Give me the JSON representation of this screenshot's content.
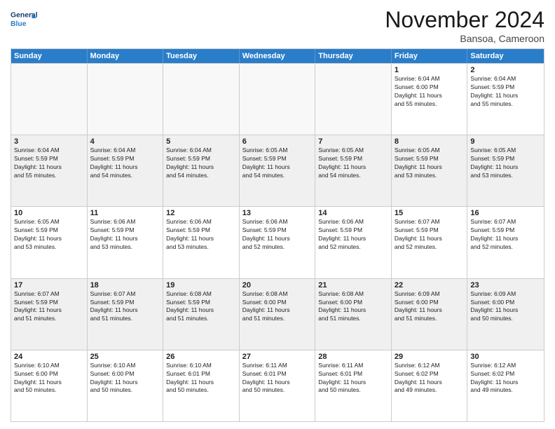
{
  "header": {
    "logo_general": "General",
    "logo_blue": "Blue",
    "month": "November 2024",
    "location": "Bansoa, Cameroon"
  },
  "weekdays": [
    "Sunday",
    "Monday",
    "Tuesday",
    "Wednesday",
    "Thursday",
    "Friday",
    "Saturday"
  ],
  "rows": [
    [
      {
        "day": "",
        "info": ""
      },
      {
        "day": "",
        "info": ""
      },
      {
        "day": "",
        "info": ""
      },
      {
        "day": "",
        "info": ""
      },
      {
        "day": "",
        "info": ""
      },
      {
        "day": "1",
        "info": "Sunrise: 6:04 AM\nSunset: 6:00 PM\nDaylight: 11 hours\nand 55 minutes."
      },
      {
        "day": "2",
        "info": "Sunrise: 6:04 AM\nSunset: 5:59 PM\nDaylight: 11 hours\nand 55 minutes."
      }
    ],
    [
      {
        "day": "3",
        "info": "Sunrise: 6:04 AM\nSunset: 5:59 PM\nDaylight: 11 hours\nand 55 minutes."
      },
      {
        "day": "4",
        "info": "Sunrise: 6:04 AM\nSunset: 5:59 PM\nDaylight: 11 hours\nand 54 minutes."
      },
      {
        "day": "5",
        "info": "Sunrise: 6:04 AM\nSunset: 5:59 PM\nDaylight: 11 hours\nand 54 minutes."
      },
      {
        "day": "6",
        "info": "Sunrise: 6:05 AM\nSunset: 5:59 PM\nDaylight: 11 hours\nand 54 minutes."
      },
      {
        "day": "7",
        "info": "Sunrise: 6:05 AM\nSunset: 5:59 PM\nDaylight: 11 hours\nand 54 minutes."
      },
      {
        "day": "8",
        "info": "Sunrise: 6:05 AM\nSunset: 5:59 PM\nDaylight: 11 hours\nand 53 minutes."
      },
      {
        "day": "9",
        "info": "Sunrise: 6:05 AM\nSunset: 5:59 PM\nDaylight: 11 hours\nand 53 minutes."
      }
    ],
    [
      {
        "day": "10",
        "info": "Sunrise: 6:05 AM\nSunset: 5:59 PM\nDaylight: 11 hours\nand 53 minutes."
      },
      {
        "day": "11",
        "info": "Sunrise: 6:06 AM\nSunset: 5:59 PM\nDaylight: 11 hours\nand 53 minutes."
      },
      {
        "day": "12",
        "info": "Sunrise: 6:06 AM\nSunset: 5:59 PM\nDaylight: 11 hours\nand 53 minutes."
      },
      {
        "day": "13",
        "info": "Sunrise: 6:06 AM\nSunset: 5:59 PM\nDaylight: 11 hours\nand 52 minutes."
      },
      {
        "day": "14",
        "info": "Sunrise: 6:06 AM\nSunset: 5:59 PM\nDaylight: 11 hours\nand 52 minutes."
      },
      {
        "day": "15",
        "info": "Sunrise: 6:07 AM\nSunset: 5:59 PM\nDaylight: 11 hours\nand 52 minutes."
      },
      {
        "day": "16",
        "info": "Sunrise: 6:07 AM\nSunset: 5:59 PM\nDaylight: 11 hours\nand 52 minutes."
      }
    ],
    [
      {
        "day": "17",
        "info": "Sunrise: 6:07 AM\nSunset: 5:59 PM\nDaylight: 11 hours\nand 51 minutes."
      },
      {
        "day": "18",
        "info": "Sunrise: 6:07 AM\nSunset: 5:59 PM\nDaylight: 11 hours\nand 51 minutes."
      },
      {
        "day": "19",
        "info": "Sunrise: 6:08 AM\nSunset: 5:59 PM\nDaylight: 11 hours\nand 51 minutes."
      },
      {
        "day": "20",
        "info": "Sunrise: 6:08 AM\nSunset: 6:00 PM\nDaylight: 11 hours\nand 51 minutes."
      },
      {
        "day": "21",
        "info": "Sunrise: 6:08 AM\nSunset: 6:00 PM\nDaylight: 11 hours\nand 51 minutes."
      },
      {
        "day": "22",
        "info": "Sunrise: 6:09 AM\nSunset: 6:00 PM\nDaylight: 11 hours\nand 51 minutes."
      },
      {
        "day": "23",
        "info": "Sunrise: 6:09 AM\nSunset: 6:00 PM\nDaylight: 11 hours\nand 50 minutes."
      }
    ],
    [
      {
        "day": "24",
        "info": "Sunrise: 6:10 AM\nSunset: 6:00 PM\nDaylight: 11 hours\nand 50 minutes."
      },
      {
        "day": "25",
        "info": "Sunrise: 6:10 AM\nSunset: 6:00 PM\nDaylight: 11 hours\nand 50 minutes."
      },
      {
        "day": "26",
        "info": "Sunrise: 6:10 AM\nSunset: 6:01 PM\nDaylight: 11 hours\nand 50 minutes."
      },
      {
        "day": "27",
        "info": "Sunrise: 6:11 AM\nSunset: 6:01 PM\nDaylight: 11 hours\nand 50 minutes."
      },
      {
        "day": "28",
        "info": "Sunrise: 6:11 AM\nSunset: 6:01 PM\nDaylight: 11 hours\nand 50 minutes."
      },
      {
        "day": "29",
        "info": "Sunrise: 6:12 AM\nSunset: 6:02 PM\nDaylight: 11 hours\nand 49 minutes."
      },
      {
        "day": "30",
        "info": "Sunrise: 6:12 AM\nSunset: 6:02 PM\nDaylight: 11 hours\nand 49 minutes."
      }
    ]
  ]
}
